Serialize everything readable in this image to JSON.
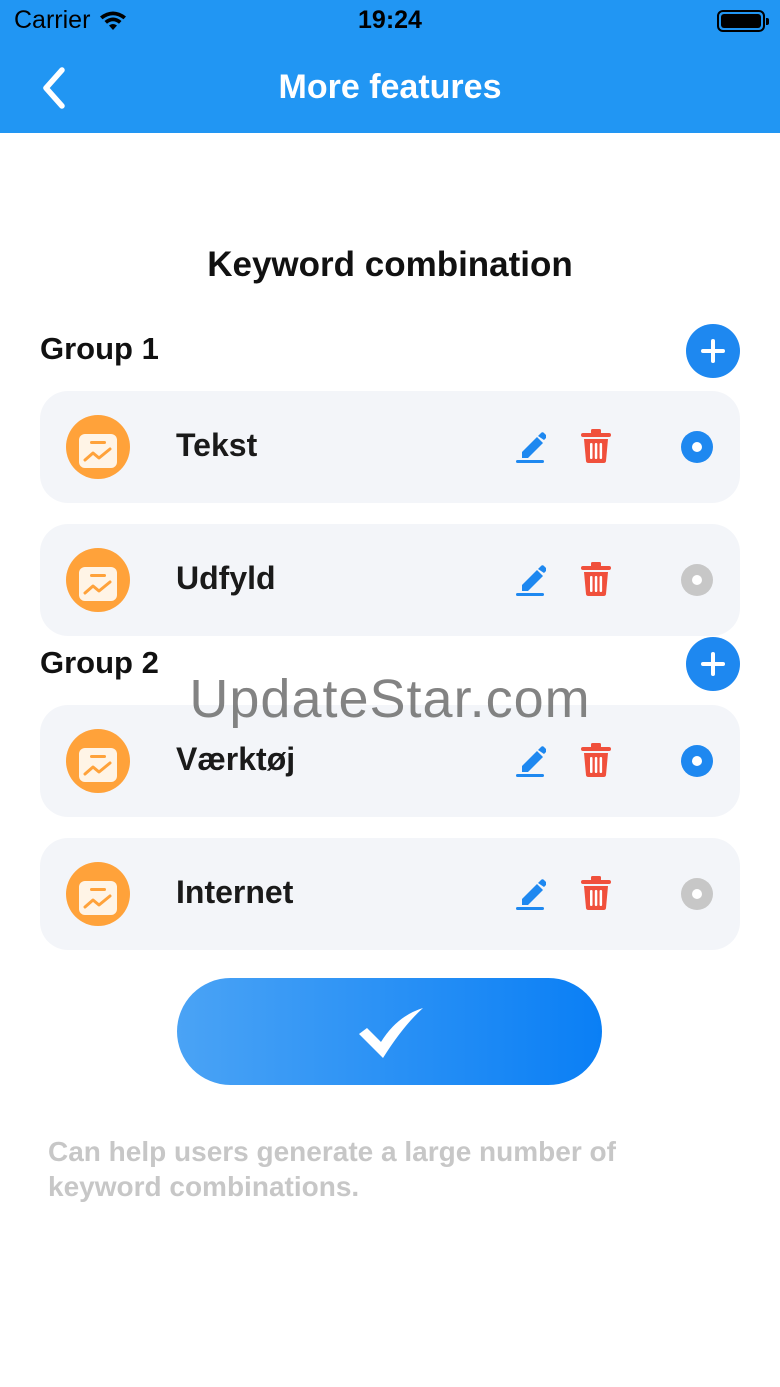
{
  "status_bar": {
    "carrier": "Carrier",
    "time": "19:24",
    "icons": [
      "wifi-icon",
      "battery-icon"
    ]
  },
  "nav": {
    "back_icon": "chevron-left-icon",
    "title": "More features"
  },
  "section_title": "Keyword combination",
  "groups": [
    {
      "label": "Group 1",
      "items": [
        {
          "label": "Tekst",
          "selected": true
        },
        {
          "label": "Udfyld",
          "selected": false
        }
      ]
    },
    {
      "label": "Group 2",
      "items": [
        {
          "label": "Værktøj",
          "selected": true
        },
        {
          "label": "Internet",
          "selected": false
        }
      ]
    }
  ],
  "watermark": "UpdateStar.com",
  "confirm_icon": "checkmark-icon",
  "note": "Can help users generate a large number of keyword combinations.",
  "colors": {
    "header": "#2196f3",
    "accent": "#1e88f0",
    "delete": "#f0503c",
    "app_icon": "#ffa23a",
    "card": "#f3f5f9",
    "muted": "#c7c7c7"
  }
}
